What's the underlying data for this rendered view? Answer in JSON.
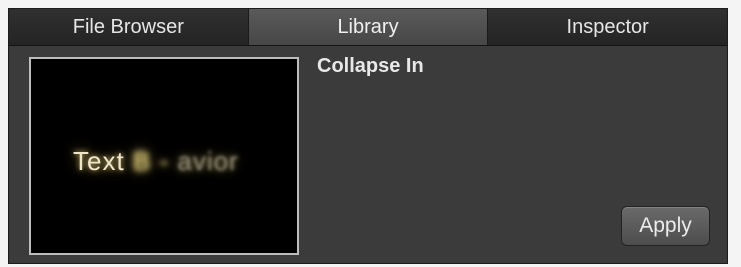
{
  "tabs": [
    {
      "label": "File Browser",
      "active": false
    },
    {
      "label": "Library",
      "active": true
    },
    {
      "label": "Inspector",
      "active": false
    }
  ],
  "preview": {
    "text_visible": "Text",
    "text_middle": " B -",
    "text_end": " avior"
  },
  "item": {
    "title": "Collapse In"
  },
  "actions": {
    "apply_label": "Apply"
  },
  "colors": {
    "panel_bg": "#3b3b3b",
    "tab_active_bg": "#505050",
    "tab_inactive_bg": "#2a2a2a",
    "preview_bg": "#000000"
  }
}
